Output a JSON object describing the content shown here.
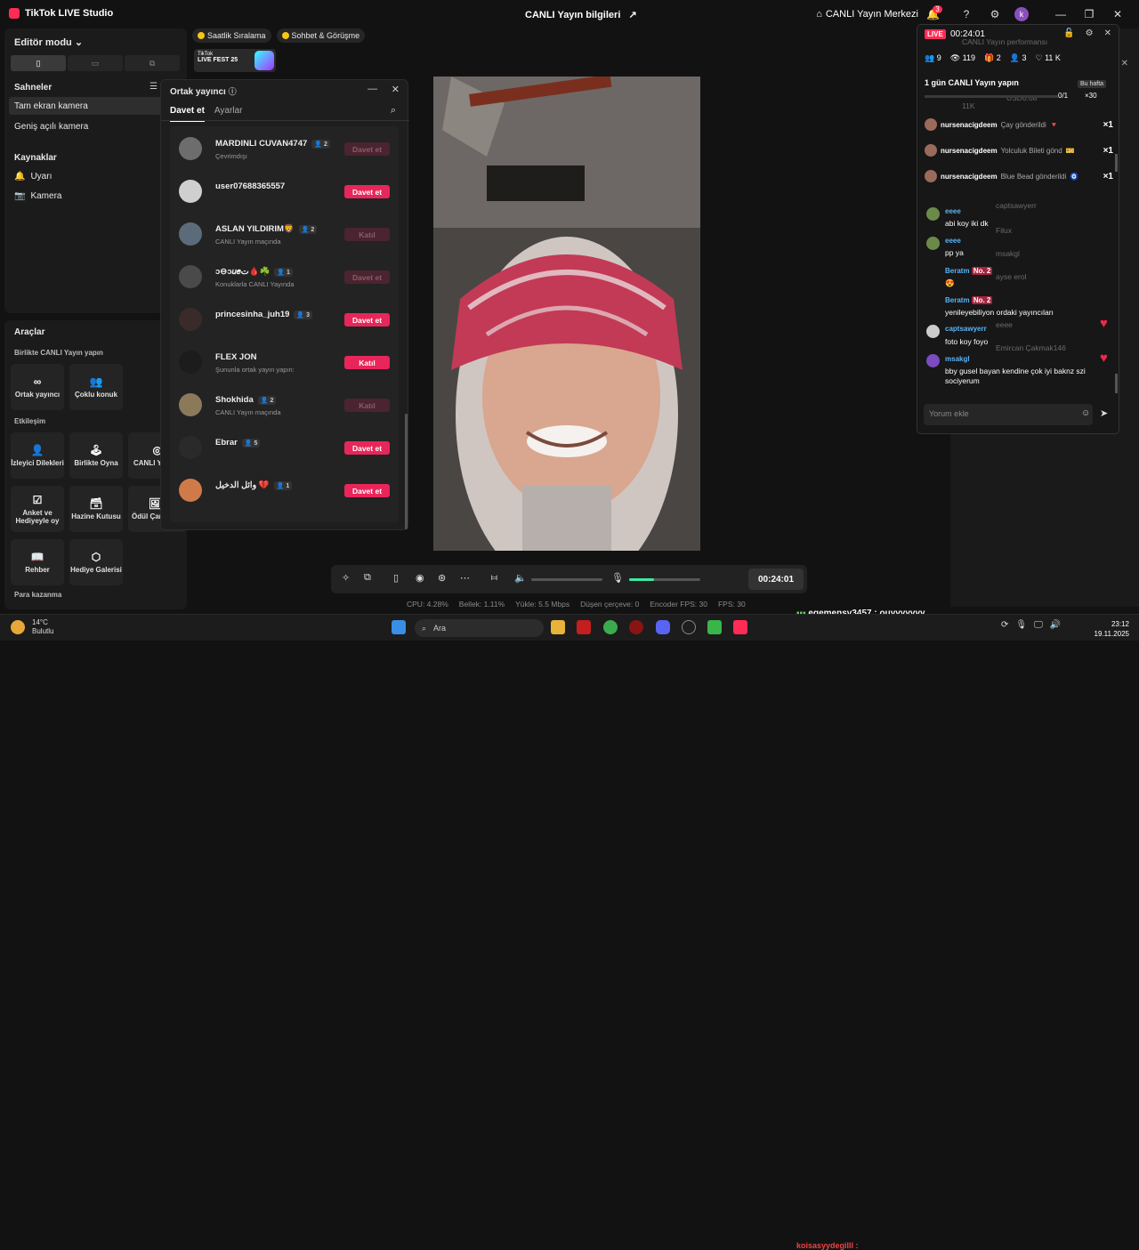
{
  "titlebar": {
    "app_name": "TikTok LIVE Studio",
    "window_title": "CANLI Yayın bilgileri",
    "live_center": "CANLI Yayın Merkezi",
    "notif_count": "3",
    "avatar_letter": "k"
  },
  "editor": {
    "title": "Editör modu",
    "scenes_title": "Sahneler",
    "scenes": [
      "Tam ekran kamera",
      "Geniş açılı kamera"
    ],
    "sources_title": "Kaynaklar",
    "sources": [
      "Uyarı",
      "Kamera"
    ]
  },
  "tools": {
    "title": "Araçlar",
    "section1": "Birlikte CANLI Yayın yapın",
    "coop": [
      "Ortak yayıncı",
      "Çoklu konuk"
    ],
    "section2": "Etkileşim",
    "interact": [
      "İzleyici Dilekleri",
      "Birlikte Oyna",
      "CANLI Yayın Hedefi",
      "Anket ve Hediyeyle oy",
      "Hazine Kutusu",
      "Ödül Çarkı",
      "Rehber",
      "Hediye Galerisi"
    ],
    "section3": "Para kazanma"
  },
  "top_pills": [
    "Saatlik Sıralama",
    "Sohbet & Görüşme"
  ],
  "fest": {
    "brand": "TikTok",
    "name": "LIVE FEST 25"
  },
  "cohost": {
    "title": "Ortak yayıncı",
    "tabs": [
      "Davet et",
      "Ayarlar"
    ],
    "rows": [
      {
        "name": "MARDINLI CUVAN4747",
        "count": "2",
        "sub": "Çevrimdışı",
        "btn": "Davet et",
        "dim": true
      },
      {
        "name": "user07688365557",
        "count": "",
        "sub": "",
        "btn": "Davet et",
        "dim": false
      },
      {
        "name": "ASLAN YILDIRIM🦁",
        "count": "2",
        "sub": "CANLI Yayın maçında",
        "btn": "Katıl",
        "dim": true
      },
      {
        "name": "ᴐ⊖ᴐ𝑢𝑒ﺕ🩸☘️",
        "count": "1",
        "sub": "Konuklarla CANLI Yayında",
        "btn": "Davet et",
        "dim": true
      },
      {
        "name": "princesinha_juh19",
        "count": "3",
        "sub": "",
        "btn": "Davet et",
        "dim": false
      },
      {
        "name": "FLEX JON",
        "count": "",
        "sub": "Şununla ortak yayın yapın:",
        "btn": "Katıl",
        "dim": false
      },
      {
        "name": "Shokhida",
        "count": "2",
        "sub": "CANLI Yayın maçında",
        "btn": "Katıl",
        "dim": true
      },
      {
        "name": "Ebrar",
        "count": "5",
        "sub": "",
        "btn": "Davet et",
        "dim": false
      },
      {
        "name": "وائل الدخيل 💔",
        "count": "1",
        "sub": "",
        "btn": "Davet et",
        "dim": false
      }
    ]
  },
  "controls": {
    "timer": "00:24:01",
    "mic_level": 0.35,
    "volume_level": 0.0
  },
  "stats": {
    "cpu": "CPU:  4.28%",
    "mem": "Bellek:  1.11%",
    "upload": "Yükle:  5.5 Mbps",
    "dropped": "Düşen çerçeve:  0",
    "encoder": "Encoder FPS:  30",
    "fps": "FPS:  30"
  },
  "live_panel": {
    "tag": "LIVE",
    "time": "00:24:01",
    "stats": [
      "9",
      "119",
      "2",
      "3",
      "11 K"
    ],
    "oneday": "1 gün CANLI Yayın yapın",
    "bu_hafta": "Bu hafta",
    "ratio": "0/1",
    "multiplier": "×30",
    "ghost_title": "CANLI Yayın performansı",
    "ghost_usd": "USD0.68",
    "ghost_likes": "11K",
    "gifts": [
      {
        "name": "nursenacigdeem",
        "desc": "Çay gönderildi",
        "x": "×1"
      },
      {
        "name": "nursenacigdeem",
        "desc": "Yolculuk Bileti gönd",
        "x": "×1"
      },
      {
        "name": "nursenacigdeem",
        "desc": "Blue Bead gönderildi",
        "x": "×1"
      }
    ],
    "chat": [
      {
        "name": "eeee",
        "text": "abi koy iki dk"
      },
      {
        "name": "eeee",
        "text": "pp ya"
      },
      {
        "name": "Beratm",
        "text": "😍"
      },
      {
        "name": "Beratm",
        "text": "yenileyebiliyon ordaki yayıncıları"
      },
      {
        "name": "captsawyerr",
        "text": "foto koy foyo"
      },
      {
        "name": "msakgl",
        "text": "bby gusel bayan kendine çok iyi baknz szi sociyerum"
      }
    ],
    "ghost_names": [
      "captsawyerr",
      "Filux",
      "msakgl",
      "ayse erol",
      "eeee",
      "Emircan Çakmak146"
    ],
    "rank_badge": "No. 2",
    "comment_placeholder": "Yorum ekle"
  },
  "taskbar": {
    "temp": "14°C",
    "weather": "Bulutlu",
    "search": "Ara",
    "time": "23:12",
    "date": "19.11.2025"
  },
  "ticker": {
    "line1": "egemensv3457 : ouyyyyyyy",
    "line2": "koisasyydegilll : "
  }
}
